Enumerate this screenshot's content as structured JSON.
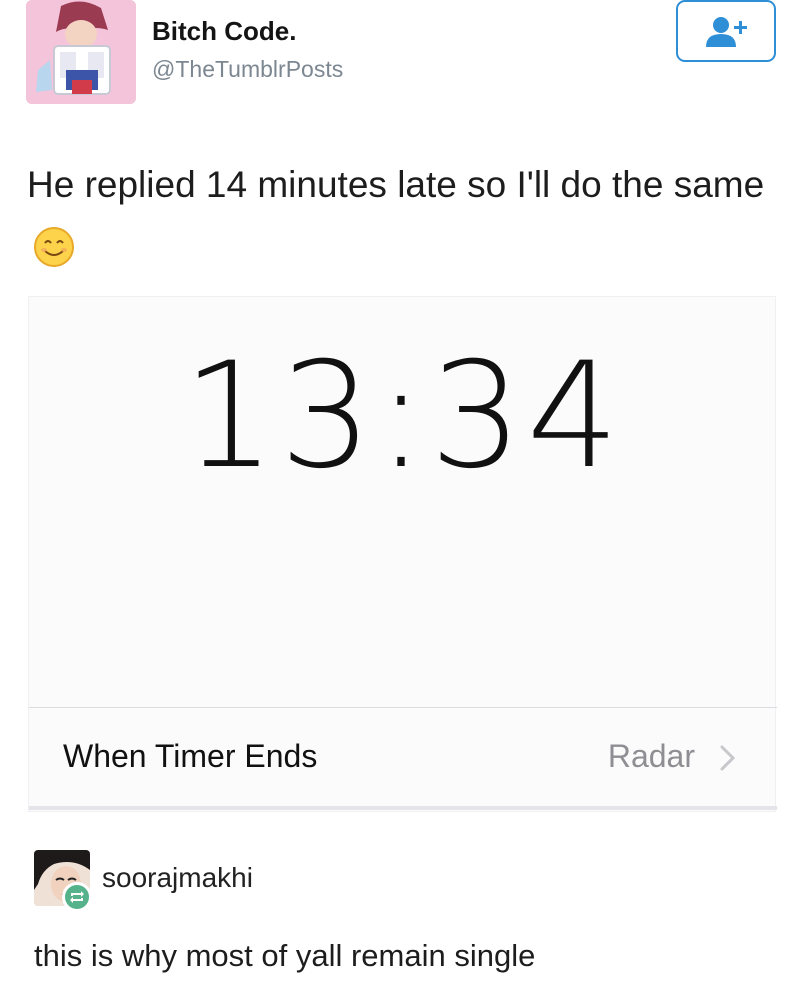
{
  "tweet": {
    "display_name": "Bitch Code.",
    "handle": "@TheTumblrPosts",
    "follow_icon": "add-user-icon",
    "text": "He replied 14 minutes late so I'll do the same",
    "emoji": "smiling-face-emoji"
  },
  "timer_screenshot": {
    "time": "13:34",
    "row_label": "When Timer Ends",
    "row_value": "Radar",
    "row_icon": "chevron-right-icon"
  },
  "reblog": {
    "username": "soorajmakhi",
    "badge_icon": "reblog-icon",
    "comment": "this is why most of yall remain single"
  },
  "colors": {
    "follow_border": "#2e8fd6",
    "handle_gray": "#7c8791",
    "reblog_green": "#56b28a",
    "secondary_gray": "#8e8e93"
  }
}
